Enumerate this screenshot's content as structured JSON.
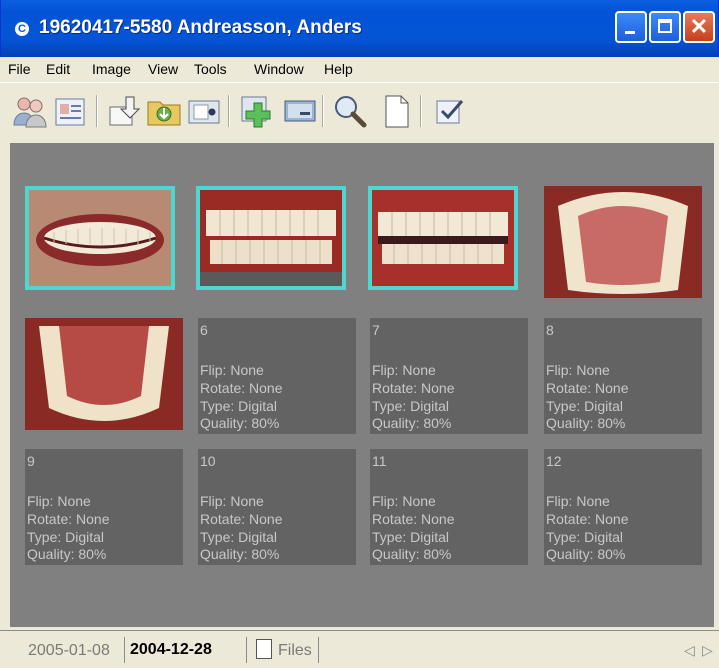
{
  "window": {
    "title": "19620417-5580 Andreasson, Anders",
    "controls": [
      "minimize",
      "maximize",
      "close"
    ]
  },
  "menu": {
    "items": [
      "File",
      "Edit",
      "Image",
      "View",
      "Tools",
      "Window",
      "Help"
    ]
  },
  "toolbar": {
    "icons": [
      "patients-icon",
      "patient-card-icon",
      "import-icon",
      "export-folder-icon",
      "camera-icon",
      "add-image-icon",
      "screen-icon",
      "magnify-icon",
      "new-document-icon",
      "checklist-icon"
    ]
  },
  "thumbnails": [
    {
      "label": "",
      "kind": "photo",
      "subject": "smile-lips",
      "selected": true
    },
    {
      "label": "",
      "kind": "photo",
      "subject": "frontal-teeth-retractor",
      "selected": true
    },
    {
      "label": "",
      "kind": "photo",
      "subject": "frontal-teeth-open",
      "selected": true
    },
    {
      "label": "",
      "kind": "photo",
      "subject": "upper-occlusal",
      "selected": false
    },
    {
      "label": "",
      "kind": "photo",
      "subject": "lower-occlusal",
      "selected": false
    }
  ],
  "placeholders": [
    {
      "num": "6",
      "flip": "Flip: None",
      "rotate": "Rotate: None",
      "type": "Type: Digital",
      "quality": "Quality: 80%"
    },
    {
      "num": "7",
      "flip": "Flip: None",
      "rotate": "Rotate: None",
      "type": "Type: Digital",
      "quality": "Quality: 80%"
    },
    {
      "num": "8",
      "flip": "Flip: None",
      "rotate": "Rotate: None",
      "type": "Type: Digital",
      "quality": "Quality: 80%"
    },
    {
      "num": "9",
      "flip": "Flip: None",
      "rotate": "Rotate: None",
      "type": "Type: Digital",
      "quality": "Quality: 80%"
    },
    {
      "num": "10",
      "flip": "Flip: None",
      "rotate": "Rotate: None",
      "type": "Type: Digital",
      "quality": "Quality: 80%"
    },
    {
      "num": "11",
      "flip": "Flip: None",
      "rotate": "Rotate: None",
      "type": "Type: Digital",
      "quality": "Quality: 80%"
    },
    {
      "num": "12",
      "flip": "Flip: None",
      "rotate": "Rotate: None",
      "type": "Type: Digital",
      "quality": "Quality: 80%"
    }
  ],
  "tabs": {
    "inactive": "2005-01-08",
    "active": "2004-12-28",
    "files": "Files"
  },
  "nav": {
    "prev": "◁",
    "next": "▷"
  },
  "colors": {
    "selection": "#4fd6d0",
    "background": "#808080",
    "placeholder": "#636363"
  }
}
